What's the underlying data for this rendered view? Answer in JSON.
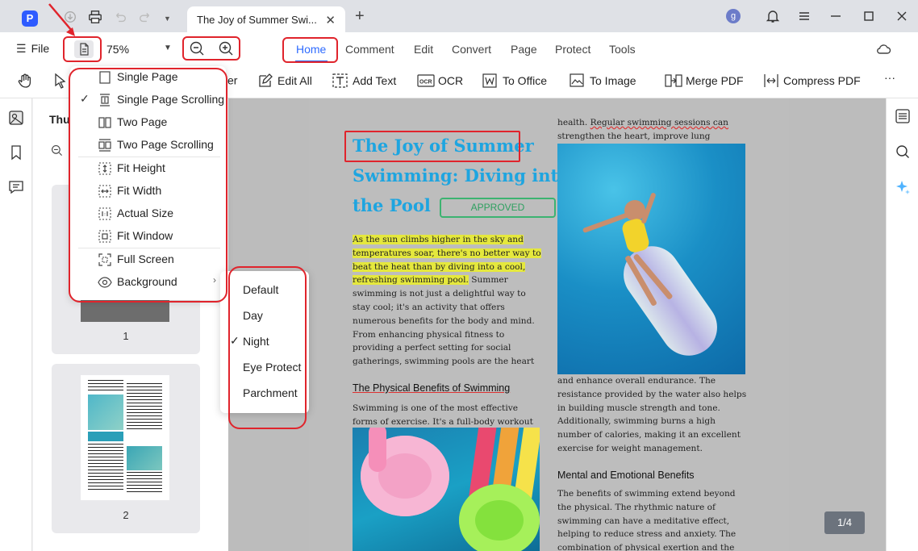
{
  "window": {
    "tab_title": "The Joy of Summer Swi...",
    "tab_close": "✕",
    "new_tab": "+",
    "avatar_letter": "g",
    "logo_letter": "P"
  },
  "toolbar": {
    "file_label": "File",
    "zoom_value": "75%",
    "nav_tabs": [
      "Home",
      "Comment",
      "Edit",
      "Convert",
      "Page",
      "Protect",
      "Tools"
    ],
    "active_tab": "Home"
  },
  "tools": {
    "partial_label": "er",
    "edit_all": "Edit All",
    "add_text": "Add Text",
    "ocr": "OCR",
    "to_office": "To Office",
    "to_image": "To Image",
    "merge_pdf": "Merge PDF",
    "compress_pdf": "Compress PDF",
    "more": "···"
  },
  "thumbnails": {
    "title": "Thu",
    "pages": [
      "1",
      "2"
    ]
  },
  "view_menu": {
    "items": [
      {
        "label": "Single Page",
        "icon": "single-page-icon",
        "checked": false
      },
      {
        "label": "Single Page Scrolling",
        "icon": "single-page-scrolling-icon",
        "checked": true
      },
      {
        "label": "Two Page",
        "icon": "two-page-icon",
        "checked": false
      },
      {
        "label": "Two Page Scrolling",
        "icon": "two-page-scrolling-icon",
        "checked": false
      },
      {
        "label": "Fit Height",
        "icon": "fit-height-icon",
        "checked": false
      },
      {
        "label": "Fit Width",
        "icon": "fit-width-icon",
        "checked": false
      },
      {
        "label": "Actual Size",
        "icon": "actual-size-icon",
        "checked": false
      },
      {
        "label": "Fit Window",
        "icon": "fit-window-icon",
        "checked": false
      },
      {
        "label": "Full Screen",
        "icon": "full-screen-icon",
        "checked": false
      },
      {
        "label": "Background",
        "icon": "eye-icon",
        "checked": false
      }
    ],
    "check_mark": "✓",
    "submenu_arrow": "›"
  },
  "background_menu": {
    "items": [
      "Default",
      "Day",
      "Night",
      "Eye Protect",
      "Parchment"
    ],
    "selected": "Night",
    "check_mark": "✓"
  },
  "document": {
    "title_line1": "The Joy of Summer",
    "title_line2": "Swimming: Diving into",
    "title_line3": "the Pool",
    "stamp": "APPROVED",
    "intro_highlight": "As the sun climbs higher in the sky and temperatures soar, there's no better way to beat the heat than by diving into a cool, refreshing swimming pool.",
    "intro_rest": " Summer swimming is not just a delightful way to stay cool; it's an activity that offers numerous benefits for the body and mind. From enhancing physical fitness to providing a perfect setting for social gatherings, swimming pools are the heart of summer fun.",
    "section1_title": "The Physical Benefits of Swimming",
    "section1_text": "Swimming is one of the most effective forms of exercise. It's a full-body workout that",
    "col2_top_a": "health. ",
    "col2_top_b": "Regular swimming sessions can",
    "col2_top_c": " strengthen the heart, improve lung capacity,",
    "col2_mid": "and enhance overall endurance. The resistance provided by the water also helps in building muscle strength and tone. Additionally, swimming burns a high number of calories, making it an excellent exercise for weight management.",
    "section2_title": "Mental and Emotional Benefits",
    "section2_text": "The benefits of swimming extend beyond the physical. The rhythmic nature of swimming can have a meditative effect, helping to reduce stress and anxiety. The combination of physical exertion and the calming"
  },
  "page_indicator": "1/4",
  "colors": {
    "accent": "#2e6bff",
    "title_blue": "#1ea5e0",
    "annotation_red": "#e0242c",
    "highlight": "#e5e83d",
    "stamp_green": "#2ea060"
  }
}
